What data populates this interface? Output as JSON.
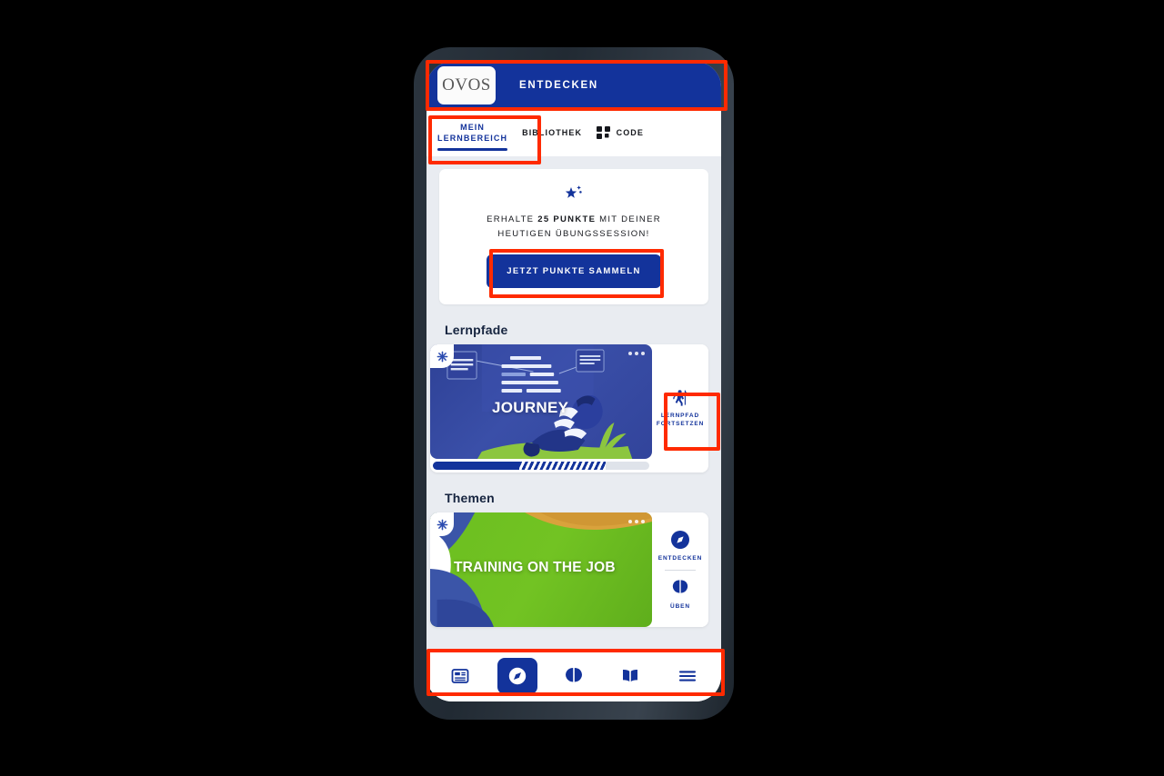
{
  "app": {
    "logo_text": "OVOS",
    "header_title": "ENTDECKEN"
  },
  "tabs": [
    {
      "label": "MEIN\nLERNBEREICH",
      "label_line1": "MEIN",
      "label_line2": "LERNBEREICH",
      "active": true
    },
    {
      "label": "BIBLIOTHEK",
      "active": false
    },
    {
      "label": "CODE",
      "icon": "qr-code-icon",
      "active": false
    }
  ],
  "points_card": {
    "icon": "sparkle-star-icon",
    "text_before": "ERHALTE ",
    "highlight": "25 PUNKTE",
    "text_after": " MIT DEINER",
    "text_line2": "HEUTIGEN ÜBUNGSSESSION!",
    "cta_label": "JETZT PUNKTE SAMMELN"
  },
  "sections": [
    {
      "title": "Lernpfade",
      "card": {
        "caption": "JOURNEY",
        "badge_icon": "snowflake-badge-icon",
        "menu_icon": "more-options-icon",
        "progress": {
          "solid_pct": 40,
          "striped_pct": 40
        },
        "actions": [
          {
            "icon": "hiker-icon",
            "label_line1": "LERNPFAD",
            "label_line2": "FORTSETZEN"
          }
        ]
      }
    },
    {
      "title": "Themen",
      "card": {
        "caption": "TRAINING ON THE JOB",
        "badge_icon": "snowflake-badge-icon",
        "menu_icon": "more-options-icon",
        "actions": [
          {
            "icon": "compass-icon",
            "label_line1": "ENTDECKEN",
            "label_line2": ""
          },
          {
            "icon": "brain-icon",
            "label_line1": "ÜBEN",
            "label_line2": ""
          }
        ]
      }
    }
  ],
  "bottom_nav": [
    {
      "icon": "dashboard-icon",
      "active": false
    },
    {
      "icon": "compass-icon",
      "active": true
    },
    {
      "icon": "brain-icon",
      "active": false
    },
    {
      "icon": "book-icon",
      "active": false
    },
    {
      "icon": "menu-icon",
      "active": false
    }
  ],
  "colors": {
    "brand_blue": "#13339b",
    "annotation_red": "#ff2a00",
    "page_bg": "#e9ecf1",
    "frame_dark": "#2b343e",
    "green": "#6cbe20"
  }
}
